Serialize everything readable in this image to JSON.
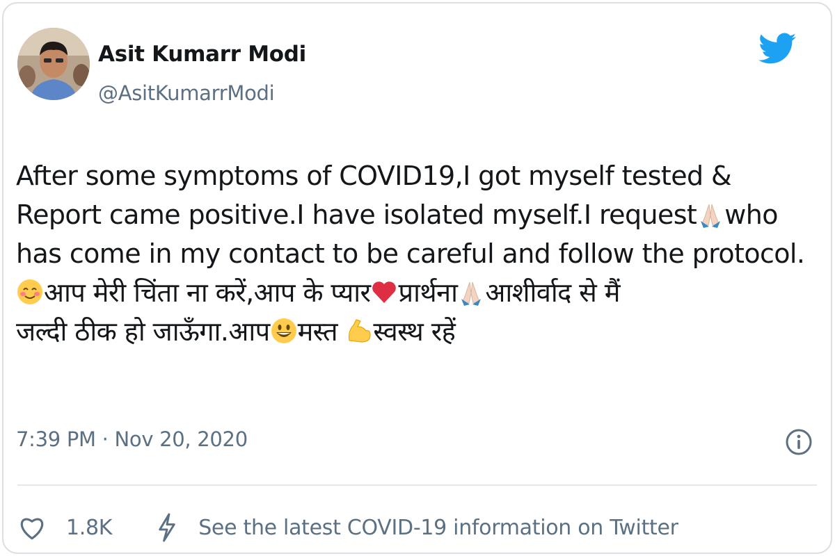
{
  "author": {
    "name": "Asit Kumarr Modi",
    "handle": "@AsitKumarrModi",
    "avatar_icon": "profile-photo"
  },
  "brand": {
    "icon": "twitter-bird-icon",
    "color": "#1da1f2"
  },
  "tweet": {
    "line1": "After some symptoms of COVID19,I got myself tested &",
    "line2a": "Report came positive.I have isolated myself.I request",
    "line2b": "who",
    "line3": "has come in my contact to be careful and follow the protocol.",
    "line4a": "आप मेरी चिंता ना करें,आप के प्यार",
    "line4b": "प्रार्थना",
    "line4c": "आशीर्वाद से मैं",
    "line5a": "जल्दी ठीक हो जाऊँगा.आप",
    "line5b": "मस्त ",
    "line5c": "स्वस्थ रहें",
    "emojis": [
      "folded-hands",
      "smiling-face",
      "red-heart",
      "folded-hands",
      "grinning-face",
      "flexed-biceps"
    ]
  },
  "meta": {
    "timestamp": "7:39 PM · Nov 20, 2020",
    "info_icon": "info-icon"
  },
  "actions": {
    "like_icon": "heart-icon",
    "likes": "1.8K",
    "covid_icon": "lightning-bolt-icon",
    "covid_link": "See the latest COVID-19 information on Twitter"
  },
  "colors": {
    "text": "#14171a",
    "secondary": "#5b7083",
    "border": "#d9dfe4",
    "heart": "#e0245e"
  }
}
